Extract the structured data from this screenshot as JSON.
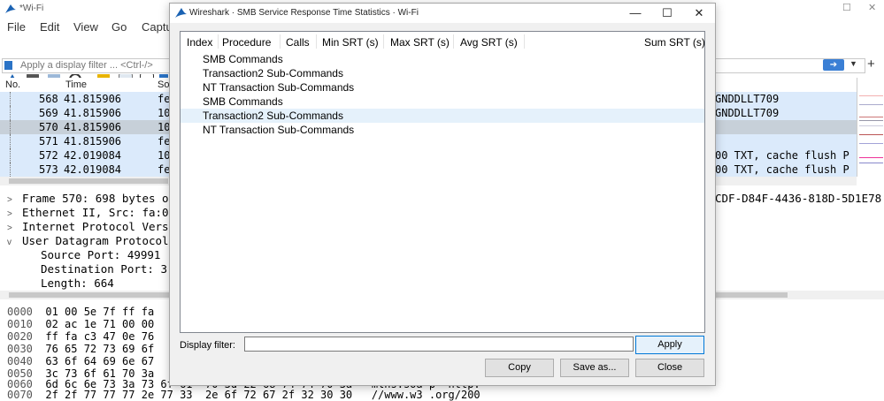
{
  "main_window": {
    "title": "*Wi-Fi",
    "menu": [
      "File",
      "Edit",
      "View",
      "Go",
      "Captu"
    ],
    "filter_placeholder": "Apply a display filter ... <Ctrl-/>",
    "packet_list": {
      "columns": [
        "No.",
        "Time",
        "So"
      ],
      "rows": [
        {
          "no": "568",
          "time": "41.815906",
          "src": "fe",
          "info": "GNDDLLT709"
        },
        {
          "no": "569",
          "time": "41.815906",
          "src": "10",
          "info": "GNDDLLT709"
        },
        {
          "no": "570",
          "time": "41.815906",
          "src": "10",
          "info": ""
        },
        {
          "no": "571",
          "time": "41.815906",
          "src": "fe",
          "info": ""
        },
        {
          "no": "572",
          "time": "42.019084",
          "src": "10",
          "info": "00 TXT, cache flush P"
        },
        {
          "no": "573",
          "time": "42.019084",
          "src": "fe",
          "info": "00 TXT, cache flush P"
        }
      ]
    },
    "details": {
      "lines": [
        {
          "caret": ">",
          "text": "Frame 570: 698 bytes o"
        },
        {
          "caret": ">",
          "text": "Ethernet II, Src: fa:0"
        },
        {
          "caret": ">",
          "text": "Internet Protocol Vers"
        },
        {
          "caret": "v",
          "text": "User Datagram Protocol"
        },
        {
          "caret": "",
          "text": "Source Port: 49991"
        },
        {
          "caret": "",
          "text": "Destination Port: 3"
        },
        {
          "caret": "",
          "text": "Length: 664"
        }
      ],
      "right_text": "CDF-D84F-4436-818D-5D1E78"
    },
    "hex": {
      "lines": [
        {
          "offset": "0000",
          "bytes": "01 00 5e 7f ff fa"
        },
        {
          "offset": "0010",
          "bytes": "02 ac 1e 71 00 00"
        },
        {
          "offset": "0020",
          "bytes": "ff fa c3 47 0e 76"
        },
        {
          "offset": "0030",
          "bytes": "76 65 72 73 69 6f"
        },
        {
          "offset": "0040",
          "bytes": "63 6f 64 69 6e 67"
        },
        {
          "offset": "0050",
          "bytes": "3c 73 6f 61 70 3a"
        },
        {
          "offset": "0060",
          "bytes": "6d 6c 6e 73 3a 73 6f 61  70 3d 22 68 74 74 70 3a",
          "ascii": "mlns:soa p=\"http:"
        },
        {
          "offset": "0070",
          "bytes": "2f 2f 77 77 77 2e 77 33  2e 6f 72 67 2f 32 30 30",
          "ascii": "//www.w3 .org/200"
        }
      ]
    }
  },
  "dialog": {
    "title": "Wireshark · SMB Service Response Time Statistics · Wi-Fi",
    "window_controls": {
      "minimize": "—",
      "maximize": "☐",
      "close": "✕"
    },
    "columns": [
      "Index",
      "Procedure",
      "Calls",
      "Min SRT (s)",
      "Max SRT (s)",
      "Avg SRT (s)",
      "Sum SRT (s)"
    ],
    "rows": [
      "SMB Commands",
      "Transaction2 Sub-Commands",
      "NT Transaction Sub-Commands",
      "SMB Commands",
      "Transaction2 Sub-Commands",
      "NT Transaction Sub-Commands"
    ],
    "highlighted_row": 4,
    "display_filter_label": "Display filter:",
    "display_filter_value": "",
    "buttons": {
      "apply": "Apply",
      "copy": "Copy",
      "save_as": "Save as...",
      "close": "Close"
    }
  },
  "colors": {
    "brand_blue": "#2b73c6",
    "selection": "#e5f1fb",
    "row_blue": "#dbeafb"
  }
}
